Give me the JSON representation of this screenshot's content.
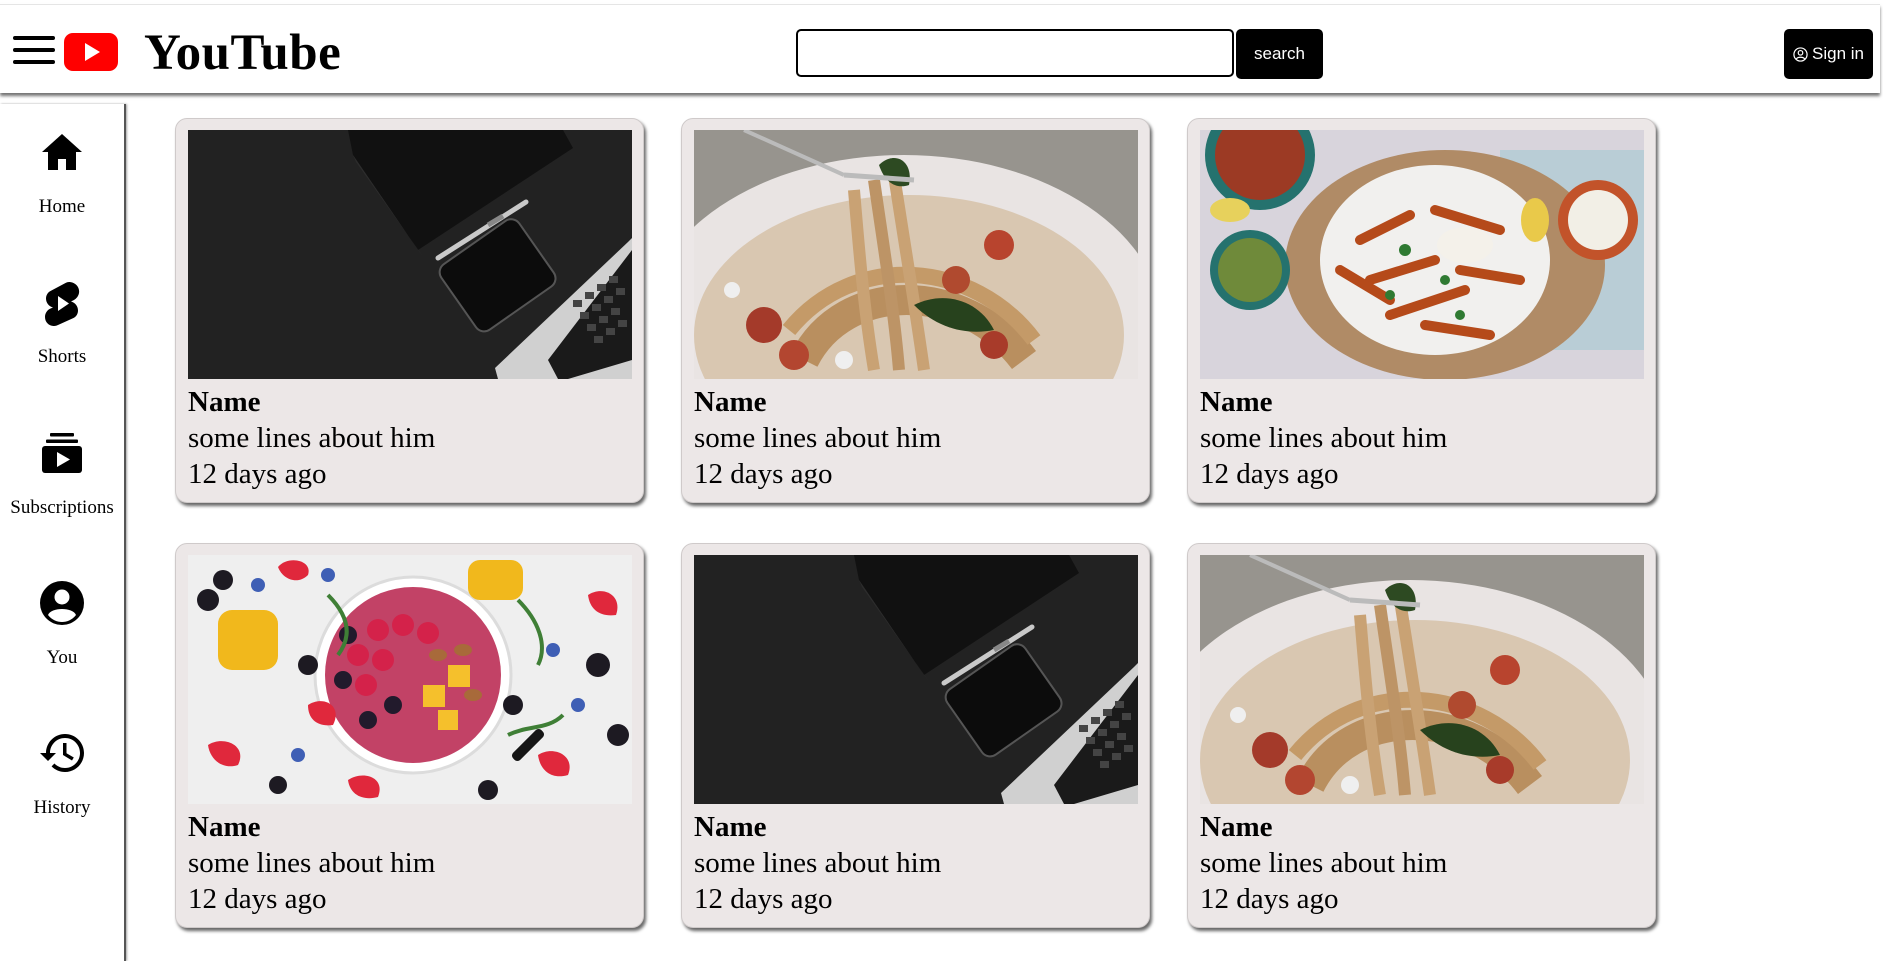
{
  "header": {
    "logo_text": "YouTube",
    "search_placeholder": "",
    "search_label": "search",
    "signin_label": "Sign in"
  },
  "sidebar": {
    "items": [
      {
        "label": "Home",
        "icon": "home-icon"
      },
      {
        "label": "Shorts",
        "icon": "shorts-icon"
      },
      {
        "label": "Subscriptions",
        "icon": "subscriptions-icon"
      },
      {
        "label": "You",
        "icon": "account-icon"
      },
      {
        "label": "History",
        "icon": "history-icon"
      }
    ]
  },
  "videos": [
    {
      "name": "Name",
      "desc": "some lines about him",
      "time": "12 days ago",
      "thumbnail": "laptop-desk-photo"
    },
    {
      "name": "Name",
      "desc": "some lines about him",
      "time": "12 days ago",
      "thumbnail": "spaghetti-fork-photo"
    },
    {
      "name": "Name",
      "desc": "some lines about him",
      "time": "12 days ago",
      "thumbnail": "sweet-potato-fries-photo"
    },
    {
      "name": "Name",
      "desc": "some lines about him",
      "time": "12 days ago",
      "thumbnail": "fruit-smoothie-bowl-photo"
    },
    {
      "name": "Name",
      "desc": "some lines about him",
      "time": "12 days ago",
      "thumbnail": "laptop-desk-photo"
    },
    {
      "name": "Name",
      "desc": "some lines about him",
      "time": "12 days ago",
      "thumbnail": "spaghetti-fork-photo"
    }
  ],
  "colors": {
    "brand_red": "#ff0000",
    "card_bg": "#ece7e7",
    "button_bg": "#000000"
  }
}
